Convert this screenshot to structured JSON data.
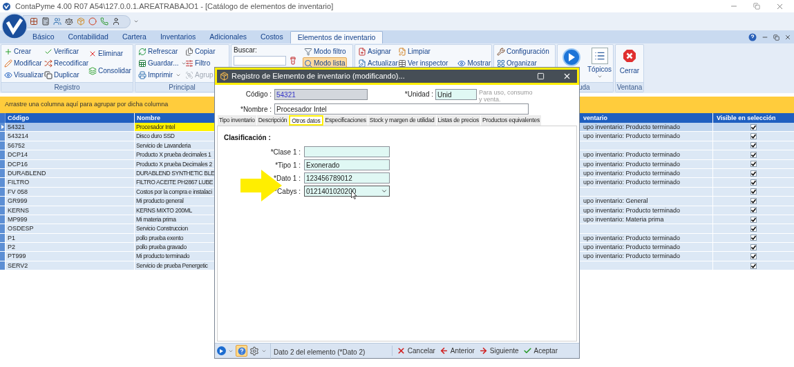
{
  "window": {
    "title": "ContaPyme 4.00 R07 A54\\127.0.0.1.AREATRABAJO1 - [Catálogo de elementos de inventario]"
  },
  "ribbon_tabs": [
    {
      "label": "Básico",
      "selected": false
    },
    {
      "label": "Contabilidad",
      "selected": false
    },
    {
      "label": "Cartera",
      "selected": false
    },
    {
      "label": "Inventarios",
      "selected": false
    },
    {
      "label": "Adicionales",
      "selected": false
    },
    {
      "label": "Costos",
      "selected": false
    },
    {
      "label": "Elementos de inventario",
      "selected": true
    }
  ],
  "ribbon_groups": [
    {
      "label": "Registro",
      "items": [
        {
          "label": "Crear"
        },
        {
          "label": "Modificar"
        },
        {
          "label": "Visualizar"
        },
        {
          "label": "Verificar"
        },
        {
          "label": "Recodificar"
        },
        {
          "label": "Duplicar"
        },
        {
          "label": "Eliminar"
        },
        {
          "label": "Consolidar"
        }
      ]
    },
    {
      "label": "Principal",
      "items": [
        {
          "label": "Refrescar",
          "disabled": false
        },
        {
          "label": "Guardar...",
          "disabled": false
        },
        {
          "label": "Imprimir",
          "disabled": false
        },
        {
          "label": "Copiar",
          "disabled": false
        },
        {
          "label": "Filtro",
          "disabled": false
        },
        {
          "label": "Agrup",
          "disabled": true
        }
      ]
    },
    {
      "search_label": "Buscar:",
      "items": [
        {
          "label": "Modo filtro",
          "selected": false
        },
        {
          "label": "Modo lista",
          "selected": true
        }
      ]
    },
    {
      "items": [
        {
          "label": "Asignar"
        },
        {
          "label": "Actualizar"
        },
        {
          "label": "Limpiar"
        },
        {
          "label": "Ver inspector"
        },
        {
          "label": "Mostrar"
        }
      ]
    },
    {
      "items": [
        {
          "label": "Configuración"
        },
        {
          "label": "Organizar"
        }
      ]
    },
    {
      "label": "uda",
      "items": [
        {
          "label": "Tópicos"
        }
      ]
    },
    {
      "label": "Ventana",
      "items": [
        {
          "label": "Cerrar"
        }
      ]
    }
  ],
  "grid": {
    "group_panel": "Arrastre una columna aquí para agrupar por dicha columna",
    "columns": [
      {
        "label": "Código"
      },
      {
        "label": "Nombre"
      },
      {
        "label": "ventario"
      },
      {
        "label": "Visible en selección"
      }
    ],
    "rows": [
      {
        "codigo": "54321",
        "nombre": "Procesador Intel",
        "column_3": "upo inventario: Producto terminado",
        "visible": true,
        "selected": true
      },
      {
        "codigo": "543214",
        "nombre": "Disco duro SSD",
        "column_3": "upo inventario: Producto terminado",
        "visible": true,
        "selected": false
      },
      {
        "codigo": "56752",
        "nombre": "Servicio de Lavanderia",
        "visible": true,
        "selected": false
      },
      {
        "codigo": "DCP14",
        "nombre": "Producto X prueba decimales 1",
        "column_3": "upo inventario: Producto terminado",
        "visible": true,
        "selected": false
      },
      {
        "codigo": "DCP16",
        "nombre": "Producto X prueba Decimales 2",
        "column_3": "upo inventario: Producto terminado",
        "visible": true,
        "selected": false
      },
      {
        "codigo": "DURABLEND",
        "nombre": "DURABLEND SYNTHETIC BLE",
        "column_3": "upo inventario: Producto terminado",
        "visible": true,
        "selected": false
      },
      {
        "codigo": "FILTRO",
        "nombre": "FILTRO ACEITE PH2867 LUBE",
        "column_3": "upo inventario: Producto terminado",
        "visible": true,
        "selected": false
      },
      {
        "codigo": "FV 058",
        "nombre": "Costos por la compra e instalaci",
        "visible": true,
        "selected": false
      },
      {
        "codigo": "GR999",
        "nombre": "Mi producto general",
        "column_3": "upo inventario: General",
        "visible": true,
        "selected": false
      },
      {
        "codigo": "KERNS",
        "nombre": "KERNS MIXTO 200ML",
        "column_3": "upo inventario: Producto terminado",
        "visible": true,
        "selected": false
      },
      {
        "codigo": "MP999",
        "nombre": "Mi materia prima",
        "column_3": "upo inventario: Materia prima",
        "visible": true,
        "selected": false
      },
      {
        "codigo": "OSDESP",
        "nombre": "Servicio Construccion",
        "visible": true,
        "selected": false
      },
      {
        "codigo": "P1",
        "nombre": "pollo prueba exento",
        "column_3": "upo inventario: Producto terminado",
        "visible": true,
        "selected": false
      },
      {
        "codigo": "P2",
        "nombre": "pollo prueba gravado",
        "column_3": "upo inventario: Producto terminado",
        "visible": true,
        "selected": false
      },
      {
        "codigo": "PT999",
        "nombre": "Mi producto terminado",
        "column_3": "upo inventario: Producto terminado",
        "visible": true,
        "selected": false
      },
      {
        "codigo": "SERV2",
        "nombre": "Servicio de prueba Penergetic",
        "visible": true,
        "selected": false
      }
    ]
  },
  "dialog": {
    "title": "Registro de Elemento de inventario (modificando)...",
    "title_highlighted": true,
    "codigo": {
      "label": "Código :",
      "value": "54321",
      "disabled": true
    },
    "unidad": {
      "label": "*Unidad :",
      "value": "Unid",
      "hint": "Para uso, consumo y venta."
    },
    "nombre": {
      "label": "*Nombre :",
      "value": "Procesador Intel"
    },
    "tabs": [
      {
        "label": "Tipo inventario",
        "selected": false,
        "highlighted": false
      },
      {
        "label": "Descripción",
        "selected": false,
        "highlighted": false
      },
      {
        "label": "Otros datos",
        "selected": true,
        "highlighted": true
      },
      {
        "label": "Especificaciones",
        "selected": false,
        "highlighted": false
      },
      {
        "label": "Stock y margen de utilidad",
        "selected": false,
        "highlighted": false
      },
      {
        "label": "Listas de precios",
        "selected": false,
        "highlighted": false
      },
      {
        "label": "Productos equivalentes",
        "selected": false,
        "highlighted": false
      }
    ],
    "section": "Clasificación :",
    "fields": [
      {
        "label": "*Clase 1 :",
        "kind": "text"
      },
      {
        "label": "*Tipo 1 :",
        "value": "Exonerado",
        "kind": "text"
      },
      {
        "label": "*Dato 1 :",
        "value": "123456789012",
        "kind": "text"
      },
      {
        "label": "*Cabys :",
        "value": "0121401020200",
        "kind": "dropdown"
      }
    ],
    "help_pressed": true,
    "status": "Dato 2 del elemento (*Dato 2)",
    "buttons": [
      {
        "label": "Cancelar"
      },
      {
        "label": "Anterior"
      },
      {
        "label": "Siguiente"
      },
      {
        "label": "Aceptar"
      }
    ]
  }
}
